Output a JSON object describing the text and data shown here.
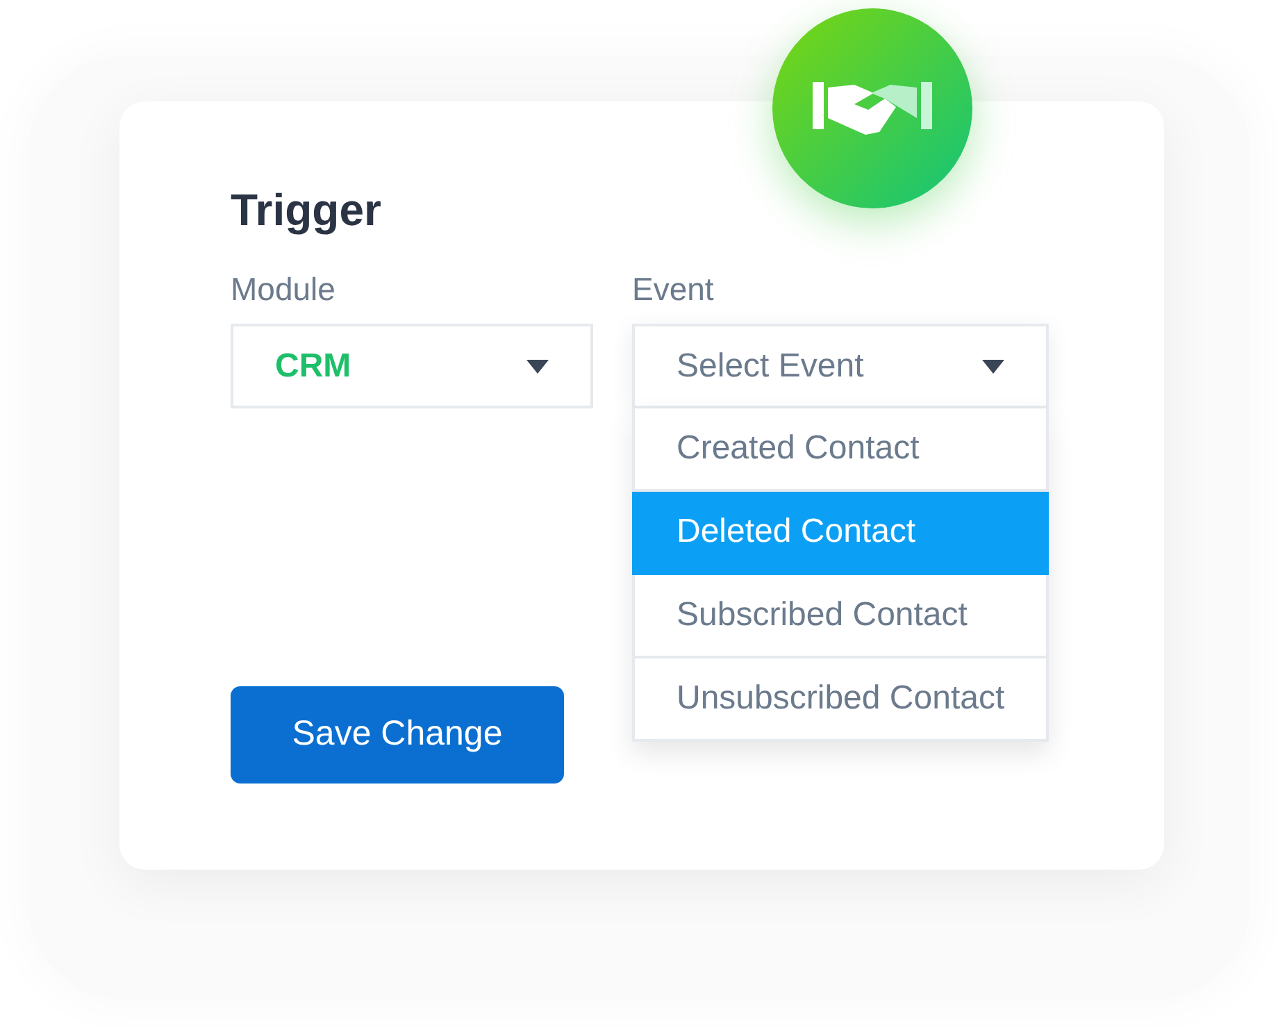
{
  "title": "Trigger",
  "fields": [
    {
      "label": "Module",
      "value": "CRM",
      "expanded": false
    },
    {
      "label": "Event",
      "placeholder": "Select Event",
      "expanded": true,
      "options": [
        {
          "label": "Created Contact",
          "selected": false
        },
        {
          "label": "Deleted Contact",
          "selected": true
        },
        {
          "label": "Subscribed Contact",
          "selected": false
        },
        {
          "label": "Unsubscribed Contact",
          "selected": false
        }
      ]
    }
  ],
  "button": "Save Change"
}
